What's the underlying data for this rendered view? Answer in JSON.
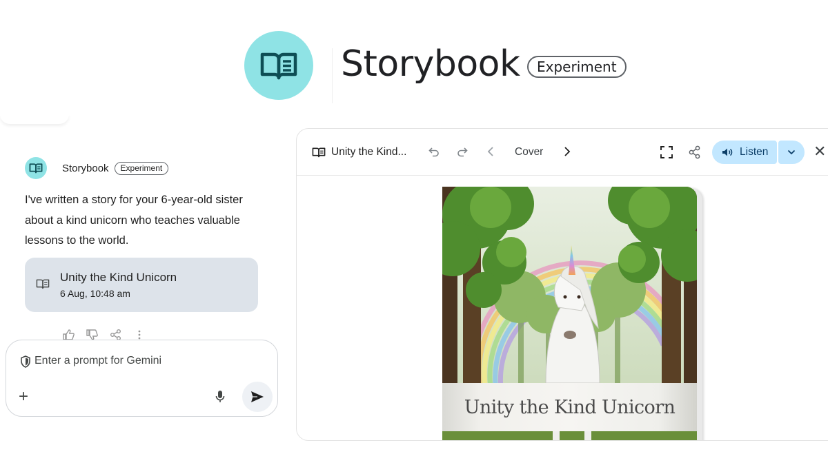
{
  "hero": {
    "title": "Storybook",
    "badge": "Experiment",
    "logo_icon": "open-book-icon",
    "logo_color": "#8fe3e5"
  },
  "chat": {
    "sender": "Storybook",
    "sender_badge": "Experiment",
    "message": "I've written a story for your 6-year-old sister about a kind unicorn who teaches valuable lessons to the world.",
    "story_card": {
      "title": "Unity the Kind Unicorn",
      "date": "6 Aug, 10:48 am",
      "icon": "open-book-icon"
    },
    "actions": [
      "thumbs-up-icon",
      "thumbs-down-icon",
      "share-icon",
      "more-vert-icon"
    ]
  },
  "prompt": {
    "placeholder": "Enter a prompt for Gemini",
    "icons": [
      "shield-icon",
      "plus-icon",
      "mic-icon",
      "send-icon"
    ]
  },
  "viewer": {
    "title": "Unity the Kind...",
    "page_label": "Cover",
    "listen_label": "Listen",
    "accent": "#c2e7ff",
    "cover_title": "Unity the Kind Unicorn"
  }
}
